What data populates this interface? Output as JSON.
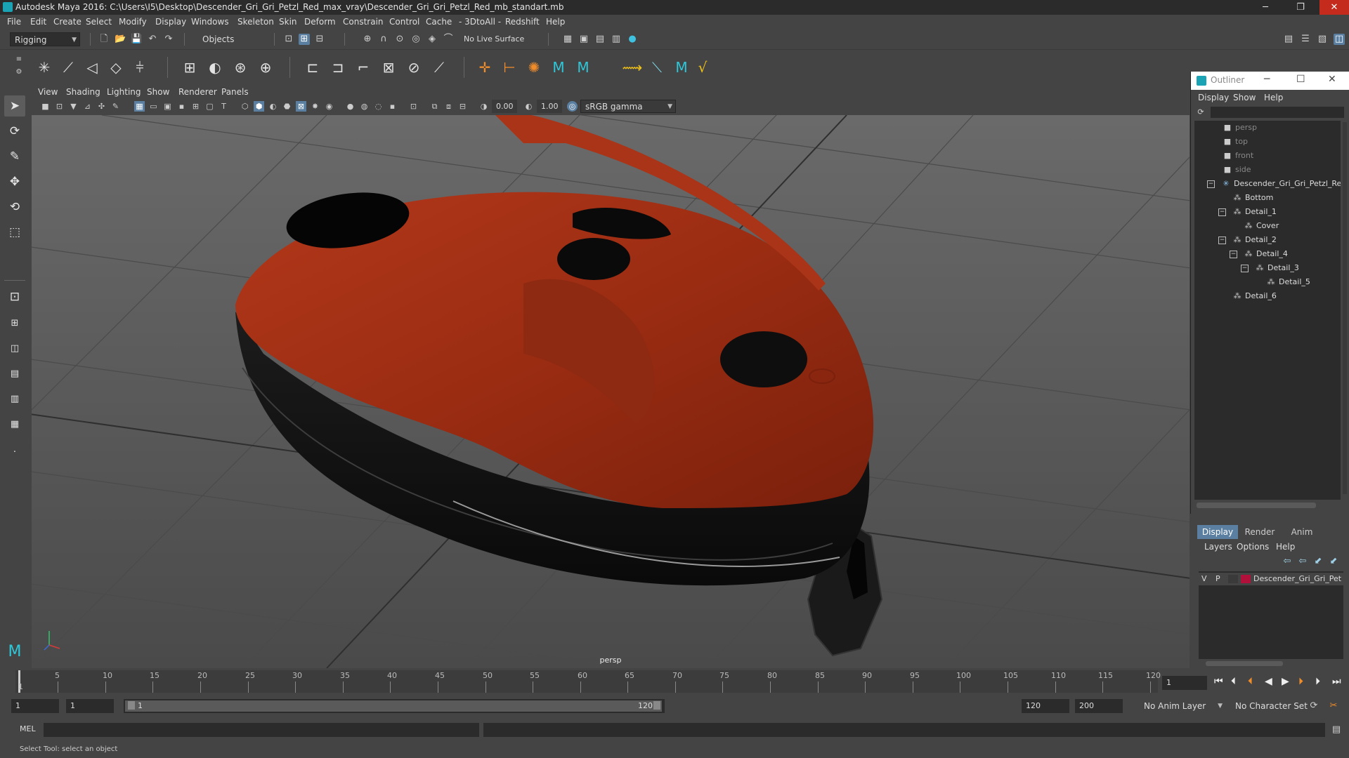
{
  "window": {
    "title": "Autodesk Maya 2016: C:\\Users\\I5\\Desktop\\Descender_Gri_Gri_Petzl_Red_max_vray\\Descender_Gri_Gri_Petzl_Red_mb_standart.mb",
    "minimize": "─",
    "restore": "❐",
    "close": "✕"
  },
  "menubar": [
    "File",
    "Edit",
    "Create",
    "Select",
    "Modify",
    "Display",
    "Windows",
    "Skeleton",
    "Skin",
    "Deform",
    "Constrain",
    "Control",
    "Cache",
    "- 3DtoAll -",
    "Redshift",
    "Help"
  ],
  "statusline": {
    "mode": "Rigging",
    "selection_mask": "Objects",
    "live_surface": "No Live Surface"
  },
  "viewport": {
    "menu": [
      "View",
      "Shading",
      "Lighting",
      "Show",
      "Renderer",
      "Panels"
    ],
    "exposure": "0.00",
    "gamma": "1.00",
    "color_space": "sRGB gamma",
    "camera_label": "persp"
  },
  "outliner": {
    "title": "Outliner",
    "menu": [
      "Display",
      "Show",
      "Help"
    ],
    "nodes": [
      {
        "label": "persp",
        "icon": "camera-icon",
        "dim": true
      },
      {
        "label": "top",
        "icon": "camera-icon",
        "dim": true
      },
      {
        "label": "front",
        "icon": "camera-icon",
        "dim": true
      },
      {
        "label": "side",
        "icon": "camera-icon",
        "dim": true
      },
      {
        "label": "Descender_Gri_Gri_Petzl_Re",
        "icon": "group-icon",
        "dim": false
      },
      {
        "label": "Bottom",
        "icon": "mesh-icon",
        "dim": false
      },
      {
        "label": "Detail_1",
        "icon": "mesh-icon",
        "dim": false
      },
      {
        "label": "Cover",
        "icon": "mesh-icon",
        "dim": false
      },
      {
        "label": "Detail_2",
        "icon": "mesh-icon",
        "dim": false
      },
      {
        "label": "Detail_4",
        "icon": "mesh-icon",
        "dim": false
      },
      {
        "label": "Detail_3",
        "icon": "mesh-icon",
        "dim": false
      },
      {
        "label": "Detail_5",
        "icon": "mesh-icon",
        "dim": false
      },
      {
        "label": "Detail_6",
        "icon": "mesh-icon",
        "dim": false
      }
    ]
  },
  "channel_box": {
    "tabs": [
      "Display",
      "Render",
      "Anim"
    ],
    "menu": [
      "Layers",
      "Options",
      "Help"
    ],
    "layer": {
      "visible": "V",
      "playback": "P",
      "name": "Descender_Gri_Gri_Pet",
      "color": "#b0103a"
    }
  },
  "timeline": {
    "ticks": [
      "5",
      "10",
      "15",
      "20",
      "25",
      "30",
      "35",
      "40",
      "45",
      "50",
      "55",
      "60",
      "65",
      "70",
      "75",
      "80",
      "85",
      "90",
      "95",
      "100",
      "105",
      "110",
      "115",
      "120"
    ],
    "start_tick": "1",
    "current_frame": "1"
  },
  "range": {
    "start": "1",
    "playback_start": "1",
    "slider_start": "1",
    "slider_end": "120",
    "playback_end": "120",
    "end": "200",
    "anim_layer": "No Anim Layer",
    "character_set": "No Character Set"
  },
  "command": {
    "lang": "MEL"
  },
  "helpline": {
    "text": "Select Tool: select an object"
  }
}
